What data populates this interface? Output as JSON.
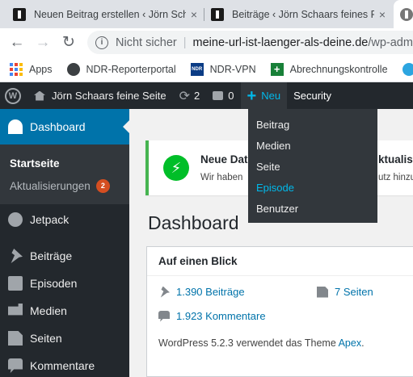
{
  "browser": {
    "tabs": [
      {
        "title": "Neuen Beitrag erstellen ‹ Jörn Schaars feines Podcast",
        "close": "×"
      },
      {
        "title": "Beiträge ‹ Jörn Schaars feines Podcast",
        "close": "×"
      }
    ],
    "nav": {
      "back": "←",
      "forward": "→",
      "reload": "↻"
    },
    "security": "Nicht sicher",
    "url_host": "meine-url-ist-laenger-als-deine.de",
    "url_path": "/wp-admin/",
    "bookmarks": [
      "Apps",
      "NDR-Reporterportal",
      "NDR-VPN",
      "Abrechnungskontrolle"
    ]
  },
  "adminbar": {
    "site": "Jörn Schaars feine Seite",
    "updates": "2",
    "comments": "0",
    "new_label": "Neu",
    "security": "Security"
  },
  "new_menu": [
    "Beitrag",
    "Medien",
    "Seite",
    "Episode",
    "Benutzer"
  ],
  "sidebar": {
    "dashboard": "Dashboard",
    "sub": {
      "home": "Startseite",
      "updates": "Aktualisierungen",
      "updates_count": "2"
    },
    "items": [
      "Jetpack",
      "Beiträge",
      "Episoden",
      "Medien",
      "Seiten",
      "Kommentare"
    ]
  },
  "notice": {
    "title_left": "Neue Dat",
    "text_left": "Wir haben",
    "title_right": "ktualisi",
    "text_right": "utz hinzu"
  },
  "main": {
    "title": "Dashboard",
    "glance": {
      "heading": "Auf einen Blick",
      "posts": "1.390 Beiträge",
      "pages": "7 Seiten",
      "comments": "1.923 Kommentare",
      "info_prefix": "WordPress 5.2.3 verwendet das Theme ",
      "theme": "Apex",
      "info_suffix": "."
    }
  },
  "colors": {
    "admin_bar": "#23282d",
    "accent": "#0073aa",
    "highlight": "#00b9eb",
    "notice_border": "#46b450",
    "badge": "#d54e21"
  }
}
